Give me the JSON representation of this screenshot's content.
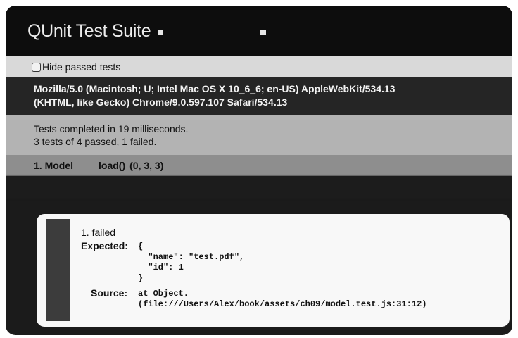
{
  "banner": {
    "title": "QUnit Test Suite",
    "crumb_1": " ",
    "crumb_2": " "
  },
  "toolbar": {
    "hide_passed_label": "Hide passed tests"
  },
  "user_agent": {
    "line_1": "Mozilla/5.0 (Macintosh; U; Intel Mac OS X 10_6_6; en-US) AppleWebKit/534.13",
    "line_2": "(KHTML, like Gecko) Chrome/9.0.597.107 Safari/534.13"
  },
  "result": {
    "line_1": "Tests completed in 19 milliseconds.",
    "line_2": "3 tests of 4 passed, 1 failed."
  },
  "tests": [
    {
      "prefix": "1. Model",
      "name": " ",
      "rest": "load()",
      "counts": "(0, 3, 3)"
    },
    {
      "prefix": " "
    }
  ],
  "assertion": {
    "label": "1. failed",
    "expected_label": "Expected:",
    "expected_value": "{\n  \"name\": \"test.pdf\",\n  \"id\": 1\n}",
    "source_label": "Source:",
    "source_value": "at Object.\n(file:///Users/Alex/book/assets/ch09/model.test.js:31:12)"
  }
}
